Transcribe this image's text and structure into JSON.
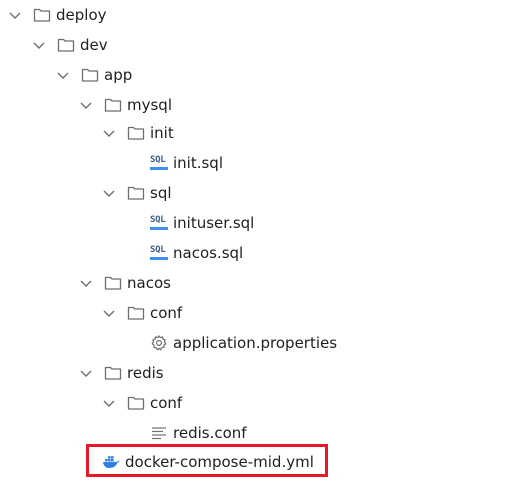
{
  "tree": {
    "deploy": "deploy",
    "dev": "dev",
    "app": "app",
    "mysql": "mysql",
    "init_folder": "init",
    "init_sql": "init.sql",
    "sql_folder": "sql",
    "inituser_sql": "inituser.sql",
    "nacos_sql": "nacos.sql",
    "nacos": "nacos",
    "nacos_conf": "conf",
    "application_properties": "application.properties",
    "redis": "redis",
    "redis_conf_folder": "conf",
    "redis_conf": "redis.conf",
    "docker_compose": "docker-compose-mid.yml"
  },
  "sql_badge": "SQL",
  "colors": {
    "folder_stroke": "#6e6e6e",
    "sql_text": "#3d5e8c",
    "sql_bar": "#3d8ff0",
    "docker": "#2f7fe0",
    "highlight": "#e8182a"
  },
  "icons": {
    "folder": "folder-icon",
    "sql": "sql-file-icon",
    "gear": "gear-icon",
    "text": "text-file-icon",
    "docker": "docker-icon",
    "chevron": "chevron-down-icon"
  }
}
